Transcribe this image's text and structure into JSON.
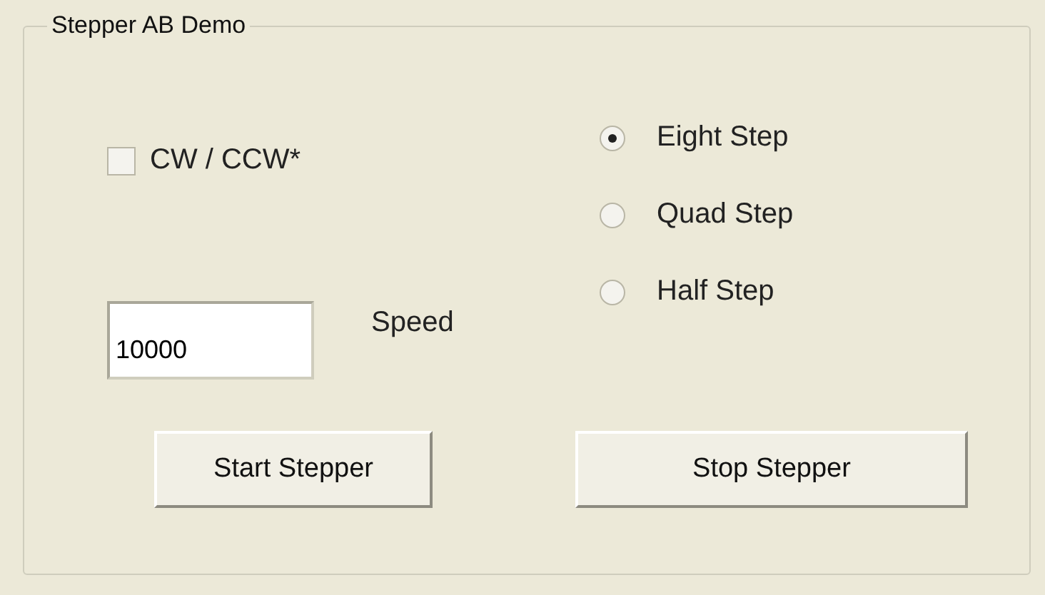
{
  "group": {
    "title": "Stepper AB Demo"
  },
  "direction": {
    "label": "CW / CCW*",
    "checked": false
  },
  "modes": [
    {
      "label": "Eight Step",
      "selected": true
    },
    {
      "label": "Quad Step",
      "selected": false
    },
    {
      "label": "Half Step",
      "selected": false
    }
  ],
  "speed": {
    "value": "10000",
    "label": "Speed"
  },
  "buttons": [
    {
      "label": "Start Stepper"
    },
    {
      "label": "Stop Stepper"
    }
  ]
}
